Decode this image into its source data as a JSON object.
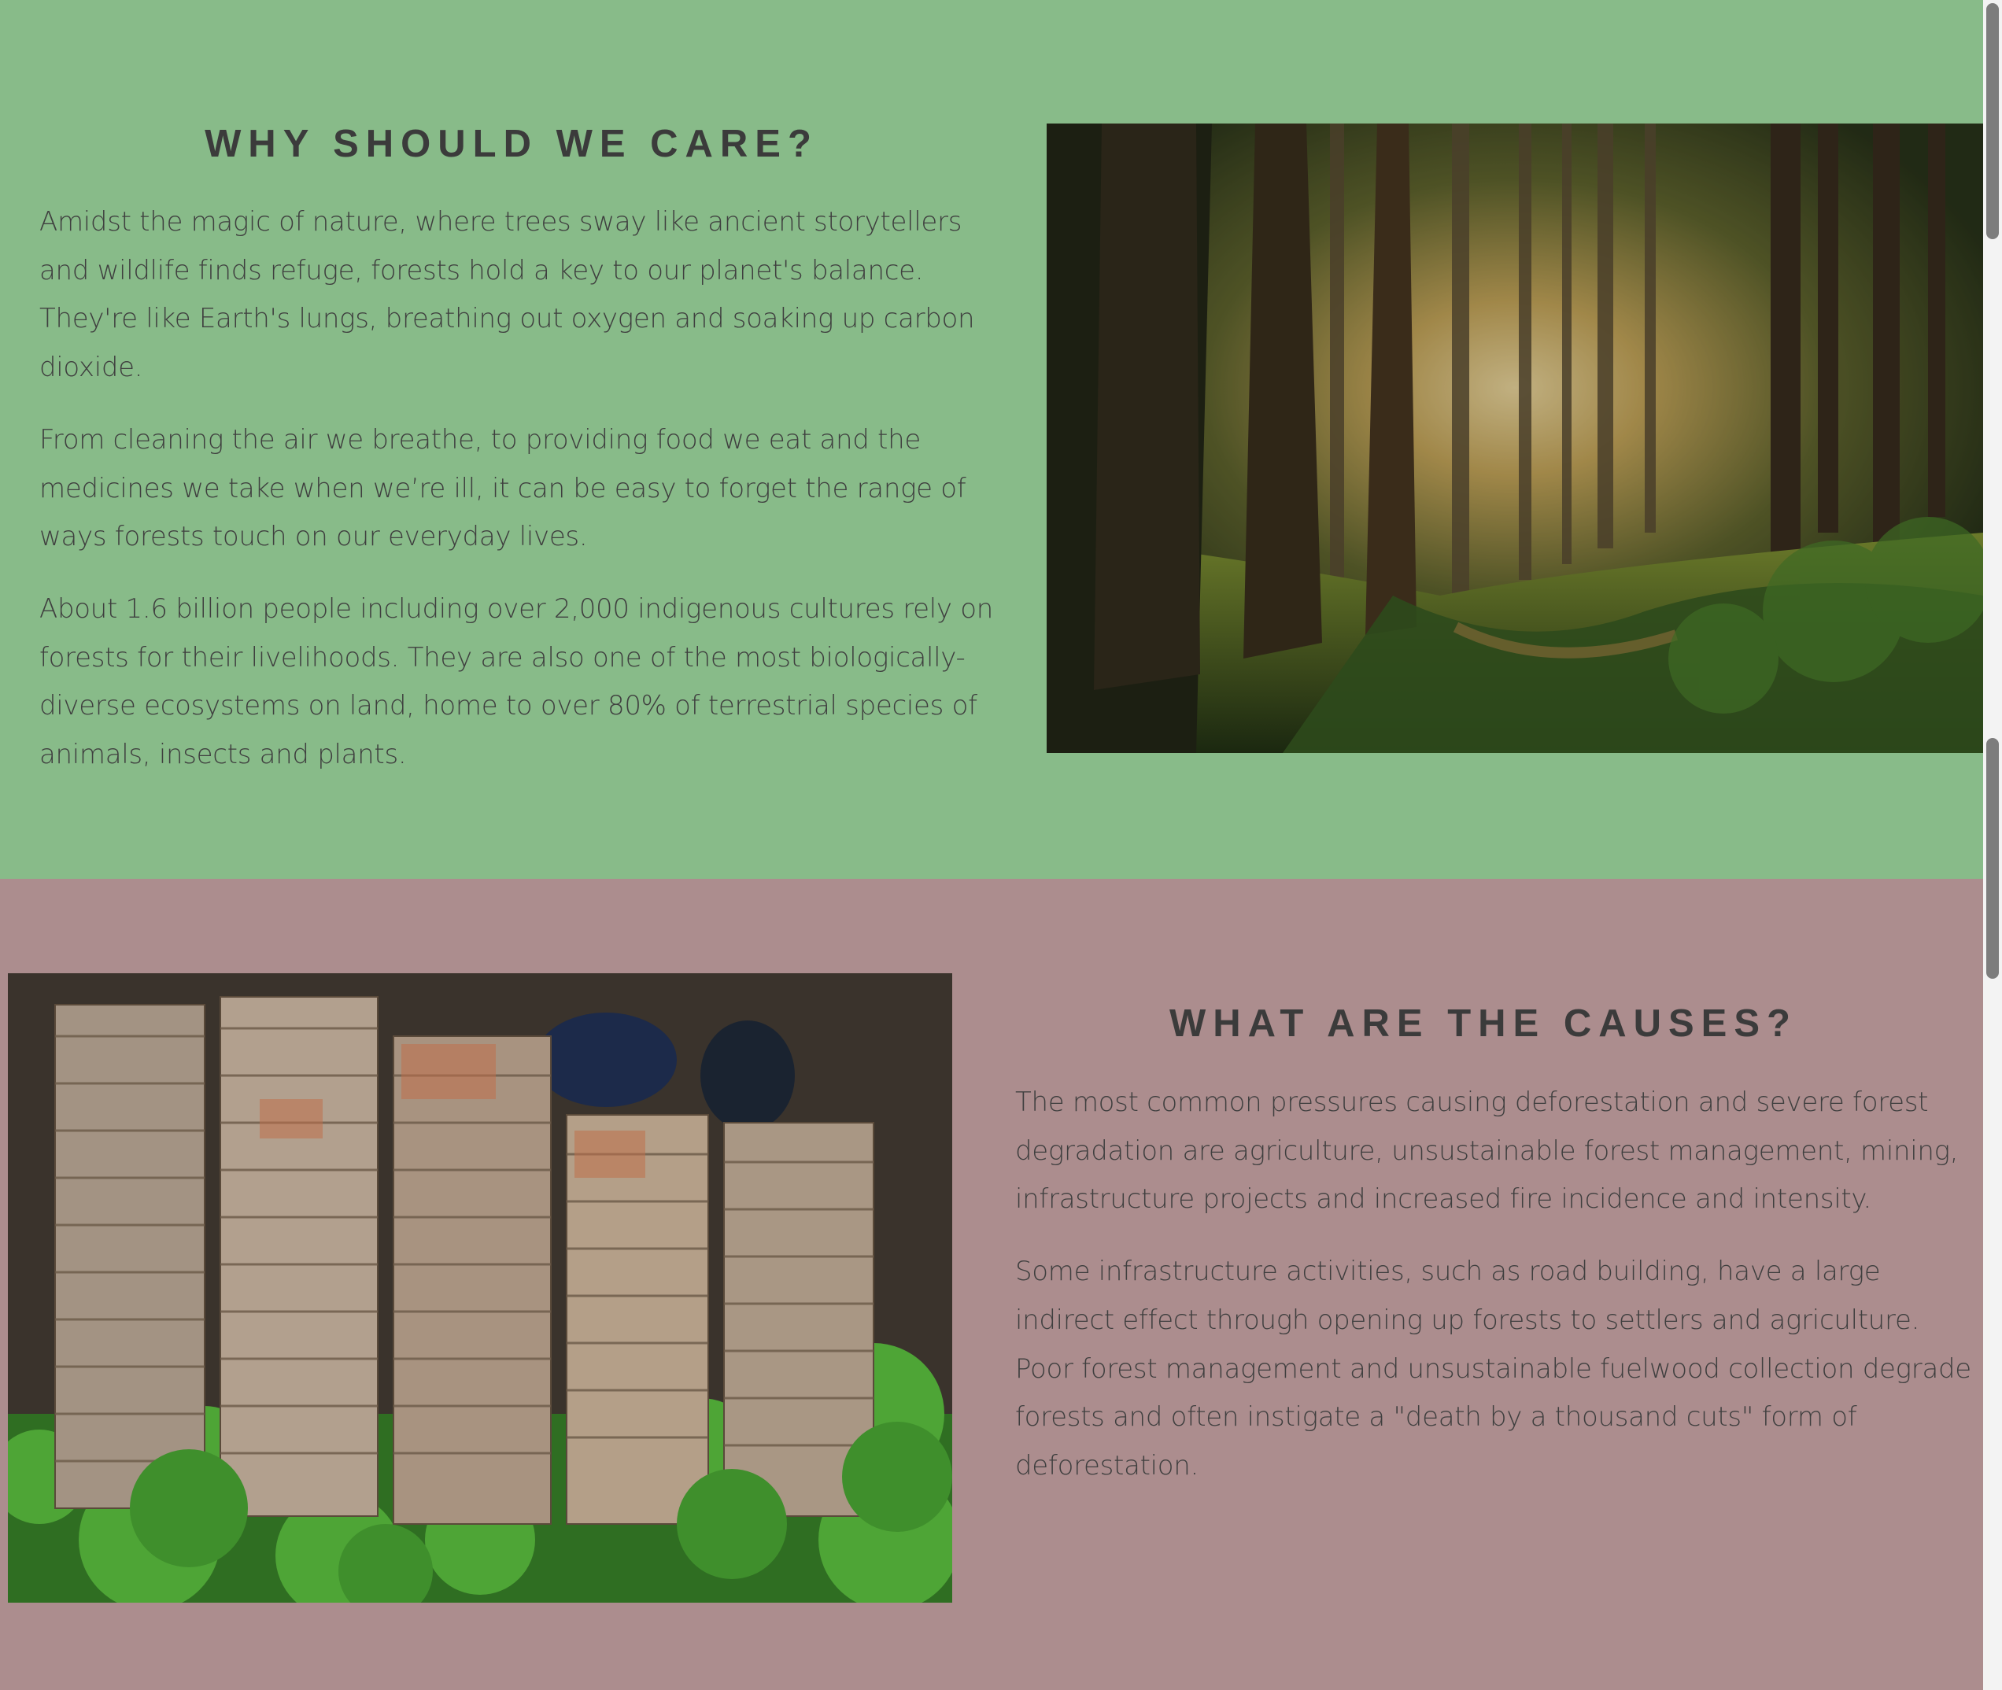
{
  "colors": {
    "care_background": "#88bb89",
    "causes_background": "#ac8d8e",
    "heading_text": "#3b3b3b",
    "body_text": "#3f3f3f"
  },
  "care": {
    "heading": "WHY SHOULD WE CARE?",
    "paragraphs": [
      "Amidst the magic of nature, where trees sway like ancient storytellers and wildlife finds refuge, forests hold a key to our planet's balance. They're like Earth's lungs, breathing out oxygen and soaking up carbon dioxide.",
      "From cleaning the air we breathe, to providing food we eat and the medicines we take when we’re ill, it can be easy to forget the range of ways forests touch on our everyday lives.",
      "About 1.6 billion people including over 2,000 indigenous cultures rely on forests for their livelihoods. They are also one of the most biologically-diverse ecosystems on land, home to over 80% of terrestrial species of animals, insects and plants."
    ],
    "image_subject": "sunlit-forest-photo"
  },
  "causes": {
    "heading": "WHAT ARE THE CAUSES?",
    "paragraphs": [
      "The most common pressures causing deforestation and severe forest degradation are agriculture, unsustainable forest management, mining, infrastructure projects and increased fire incidence and intensity.",
      "Some infrastructure activities, such as road building, have a large indirect effect through opening up forests to settlers and agriculture. Poor forest management and unsustainable fuelwood collection degrade forests and often instigate a \"death by a thousand cuts\" form of deforestation."
    ],
    "image_subject": "stacked-logs-aerial-photo"
  },
  "scrollbar": {
    "thumbs": 2
  }
}
